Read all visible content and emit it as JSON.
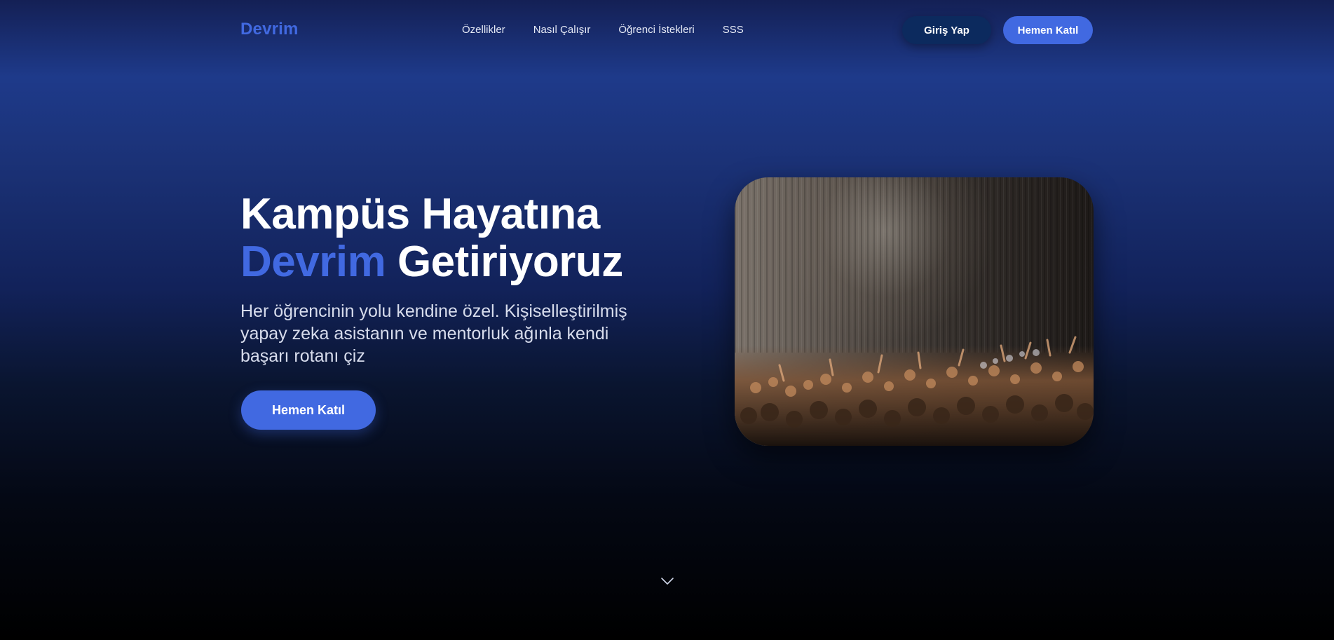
{
  "nav": {
    "logo": "Devrim",
    "links": [
      {
        "label": "Özellikler"
      },
      {
        "label": "Nasıl Çalışır"
      },
      {
        "label": "Öğrenci İstekleri"
      },
      {
        "label": "SSS"
      }
    ],
    "login_label": "Giriş Yap",
    "join_label": "Hemen Katıl"
  },
  "hero": {
    "title_line1": "Kampüs Hayatına",
    "title_accent": "Devrim",
    "title_line2_rest": " Getiriyoruz",
    "subtitle": "Her öğrencinin yolu kendine özel. Kişiselleştirilmiş yapay zeka asistanın ve mentorluk ağınla kendi başarı rotanı çiz",
    "cta_label": "Hemen Katıl",
    "image_icon": "concert-crowd-photo"
  },
  "scroll_icon": "chevron-down-icon",
  "colors": {
    "accent": "#4169e1",
    "login_button": "#0c2a5e",
    "text_light": "#d7dcec"
  }
}
